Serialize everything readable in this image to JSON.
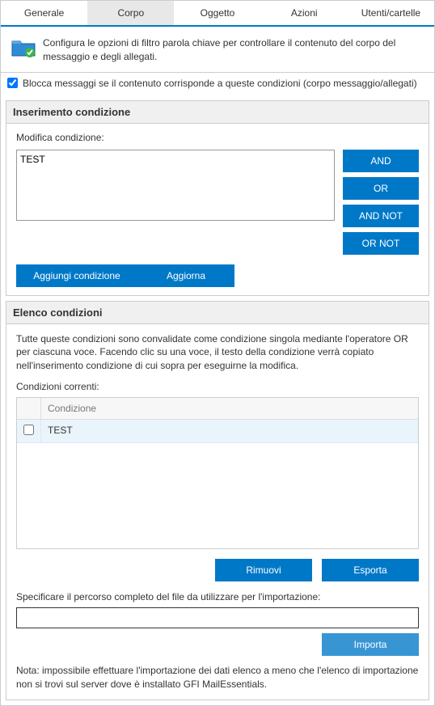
{
  "tabs": {
    "generale": "Generale",
    "corpo": "Corpo",
    "oggetto": "Oggetto",
    "azioni": "Azioni",
    "utenti": "Utenti/cartelle"
  },
  "info": {
    "text": "Configura le opzioni di filtro parola chiave per controllare il contenuto del corpo del messaggio e degli allegati."
  },
  "checkbox": {
    "label": "Blocca messaggi se il contenuto corrisponde a queste condizioni (corpo messaggio/allegati)"
  },
  "insert_panel": {
    "title": "Inserimento condizione",
    "edit_label": "Modifica condizione:",
    "text_value": "TEST",
    "btn_and": "AND",
    "btn_or": "OR",
    "btn_andnot": "AND NOT",
    "btn_ornot": "OR NOT",
    "btn_add": "Aggiungi condizione",
    "btn_update": "Aggiorna"
  },
  "list_panel": {
    "title": "Elenco condizioni",
    "desc": "Tutte queste condizioni sono convalidate come condizione singola mediante l'operatore OR per ciascuna voce. Facendo clic su una voce, il testo della condizione verrà copiato nell'inserimento condizione di cui sopra per eseguirne la modifica.",
    "current_label": "Condizioni correnti:",
    "col_condition": "Condizione",
    "rows": [
      {
        "text": "TEST"
      }
    ],
    "btn_remove": "Rimuovi",
    "btn_export": "Esporta",
    "import_label": "Specificare il percorso completo del file da utilizzare per l'importazione:",
    "btn_import": "Importa",
    "note": "Nota: impossibile effettuare l'importazione dei dati elenco a meno che l'elenco di importazione non si trovi sul server dove è installato GFI MailEssentials."
  }
}
